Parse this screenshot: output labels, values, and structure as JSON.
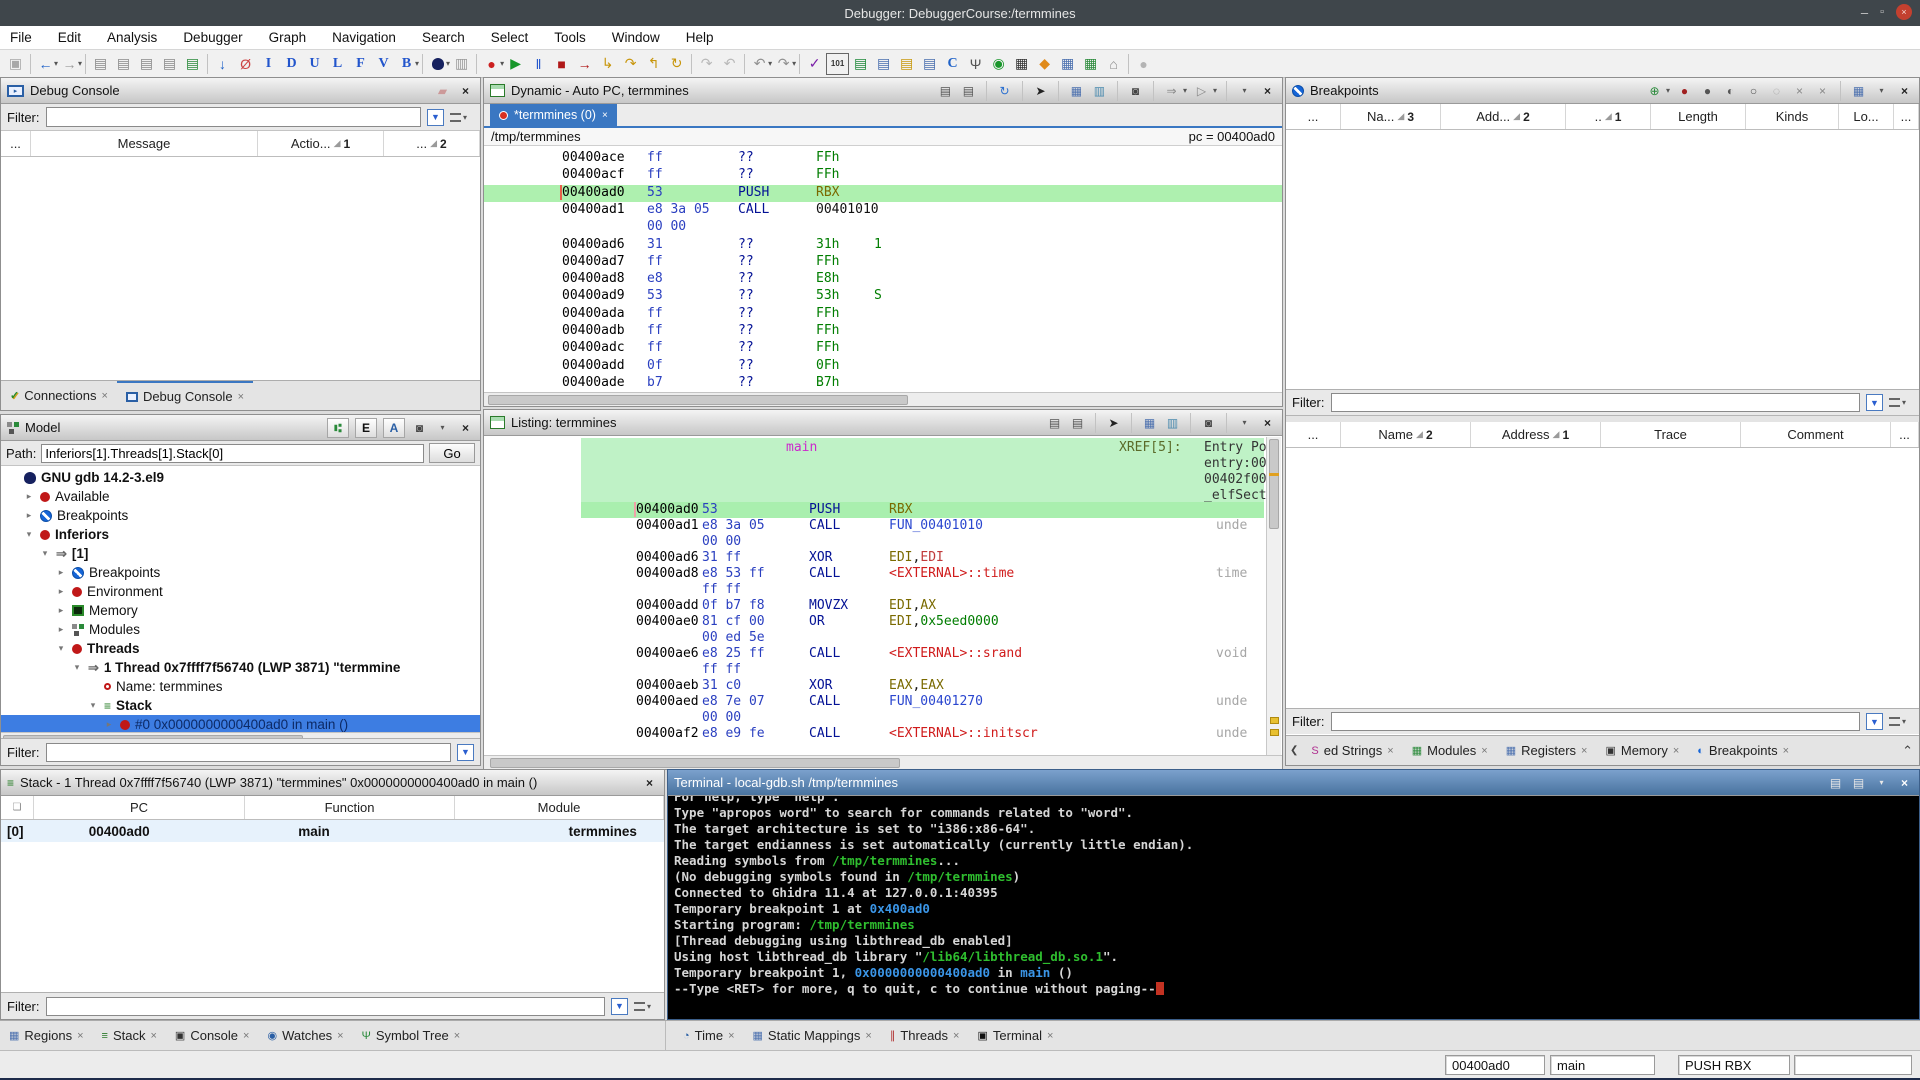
{
  "window": {
    "title": "Debugger: DebuggerCourse:/termmines"
  },
  "menu": {
    "items": [
      "File",
      "Edit",
      "Analysis",
      "Debugger",
      "Graph",
      "Navigation",
      "Search",
      "Select",
      "Tools",
      "Window",
      "Help"
    ]
  },
  "toolbar": {
    "items": [
      {
        "name": "save-button",
        "glyph": "▣",
        "color": "#a8a8a8"
      },
      {
        "name": "sep"
      },
      {
        "name": "navigate-back-button",
        "glyph": "←",
        "color": "#1f62c8",
        "caret": true
      },
      {
        "name": "navigate-forward-button",
        "glyph": "→",
        "color": "#9a9a9a",
        "caret": true
      },
      {
        "name": "sep"
      },
      {
        "name": "paste-1-button",
        "glyph": "▤",
        "color": "#8a8a8a"
      },
      {
        "name": "paste-2-button",
        "glyph": "▤",
        "color": "#8a8a8a"
      },
      {
        "name": "paste-3-button",
        "glyph": "▤",
        "color": "#8a8a8a"
      },
      {
        "name": "paste-4-button",
        "glyph": "▤",
        "color": "#8a8a8a"
      },
      {
        "name": "paste-green-button",
        "glyph": "▤",
        "color": "#2a8a3a"
      },
      {
        "name": "sep"
      },
      {
        "name": "cursor-location-button",
        "glyph": "↓",
        "color": "#1f62c8"
      },
      {
        "name": "clear-code-button",
        "glyph": "Ø",
        "color": "#cc4444"
      },
      {
        "name": "data-i-button",
        "glyph": "I",
        "color": "#2255cc"
      },
      {
        "name": "data-d-button",
        "glyph": "D",
        "color": "#2255cc"
      },
      {
        "name": "data-u-button",
        "glyph": "U",
        "color": "#2255cc"
      },
      {
        "name": "data-l-button",
        "glyph": "L",
        "color": "#2255cc"
      },
      {
        "name": "data-f-button",
        "glyph": "F",
        "color": "#2255cc"
      },
      {
        "name": "data-v-button",
        "glyph": "V",
        "color": "#2255cc"
      },
      {
        "name": "data-b-button",
        "glyph": "B",
        "color": "#2255cc",
        "caret": true
      },
      {
        "name": "sep"
      },
      {
        "name": "debug-program-button",
        "glyph": "",
        "color": "#16215f",
        "bug": true,
        "caret": true
      },
      {
        "name": "attach-button",
        "glyph": "▥",
        "color": "#9a9a9a"
      },
      {
        "name": "sep"
      },
      {
        "name": "record-button",
        "glyph": "●",
        "color": "#cc2020",
        "caret": true
      },
      {
        "name": "resume-button",
        "glyph": "▶",
        "color": "#18962a"
      },
      {
        "name": "interrupt-button",
        "glyph": "‖",
        "color": "#2255cc"
      },
      {
        "name": "kill-button",
        "glyph": "■",
        "color": "#b01818"
      },
      {
        "name": "advance-button",
        "glyph": "→",
        "color": "#b01818"
      },
      {
        "name": "step-into-button",
        "glyph": "↳",
        "color": "#c8960c"
      },
      {
        "name": "step-over-button",
        "glyph": "↷",
        "color": "#c8960c"
      },
      {
        "name": "step-out-button",
        "glyph": "↰",
        "color": "#c8960c"
      },
      {
        "name": "step-last-button",
        "glyph": "↻",
        "color": "#c8960c"
      },
      {
        "name": "sep"
      },
      {
        "name": "skip-over-button",
        "glyph": "↷",
        "color": "#b8b8b8"
      },
      {
        "name": "skip-into-button",
        "glyph": "↶",
        "color": "#b8b8b8"
      },
      {
        "name": "sep"
      },
      {
        "name": "undo-button",
        "glyph": "↶",
        "color": "#909090",
        "caret": true
      },
      {
        "name": "redo-button",
        "glyph": "↷",
        "color": "#909090",
        "caret": true
      },
      {
        "name": "sep"
      },
      {
        "name": "apply-button",
        "glyph": "✓",
        "color": "#7a1fa8"
      },
      {
        "name": "binary-button",
        "glyph": "⑁",
        "color": "#333",
        "text": "101"
      },
      {
        "name": "allocate-button",
        "glyph": "▤",
        "color": "#1f8a3a"
      },
      {
        "name": "list-1-button",
        "glyph": "▤",
        "color": "#4a6fae"
      },
      {
        "name": "dyn-folder-button",
        "glyph": "▤",
        "color": "#c89a10"
      },
      {
        "name": "list-2-button",
        "glyph": "▤",
        "color": "#4a6fae"
      },
      {
        "name": "c-type-button",
        "glyph": "C",
        "color": "#1f62c8"
      },
      {
        "name": "symbol-tree-button",
        "glyph": "Ψ",
        "color": "#555"
      },
      {
        "name": "run-script-button",
        "glyph": "◉",
        "color": "#18962a"
      },
      {
        "name": "film-button",
        "glyph": "▦",
        "color": "#333"
      },
      {
        "name": "diamond-button",
        "glyph": "◆",
        "color": "#e08a1a"
      },
      {
        "name": "table-1-button",
        "glyph": "▦",
        "color": "#4a6fae"
      },
      {
        "name": "table-2-button",
        "glyph": "▦",
        "color": "#2a8a3a"
      },
      {
        "name": "stamp-button",
        "glyph": "⌂",
        "color": "#8a8a8a"
      },
      {
        "name": "sep"
      },
      {
        "name": "snapshot-button",
        "glyph": "●",
        "color": "#b4b4b4"
      }
    ]
  },
  "debug_console": {
    "title": "Debug Console",
    "filter_label": "Filter:",
    "filter_value": "",
    "columns": [
      {
        "label": "..."
      },
      {
        "label": "Message"
      },
      {
        "label": "Actio...",
        "sort": 1
      },
      {
        "label": "...",
        "sort": 2
      }
    ],
    "tabs": [
      {
        "label": "Connections"
      },
      {
        "label": "Debug Console"
      }
    ]
  },
  "model": {
    "title": "Model",
    "path_label": "Path:",
    "path_value": "Inferiors[1].Threads[1].Stack[0]",
    "go_label": "Go",
    "filter_label": "Filter:",
    "filter_value": "",
    "tree": [
      {
        "label": "GNU gdb 14.2-3.el9",
        "icon": "bug-icon",
        "bold": true,
        "level": 0,
        "exp": ""
      },
      {
        "label": "Available",
        "icon": "red-dot-icon",
        "level": 1,
        "exp": "▸"
      },
      {
        "label": "Breakpoints",
        "icon": "breakpoint-icon",
        "level": 1,
        "exp": "▸"
      },
      {
        "label": "Inferiors",
        "icon": "red-dot-icon",
        "bold": true,
        "level": 1,
        "exp": "▾"
      },
      {
        "label": "[1]",
        "icon": "arrow-icon",
        "bold": true,
        "level": 2,
        "exp": "▾"
      },
      {
        "label": "Breakpoints",
        "icon": "breakpoint-icon",
        "level": 3,
        "exp": "▸"
      },
      {
        "label": "Environment",
        "icon": "red-dot-icon",
        "level": 3,
        "exp": "▸"
      },
      {
        "label": "Memory",
        "icon": "memory-icon",
        "level": 3,
        "exp": "▸"
      },
      {
        "label": "Modules",
        "icon": "modules-icon",
        "level": 3,
        "exp": "▸"
      },
      {
        "label": "Threads",
        "icon": "red-dot-icon",
        "bold": true,
        "level": 3,
        "exp": "▾"
      },
      {
        "label": "1    Thread 0x7ffff7f56740 (LWP 3871) \"termmine",
        "icon": "arrow-icon",
        "bold": true,
        "level": 4,
        "exp": "▾"
      },
      {
        "label": "Name: termmines",
        "icon": "ring-icon",
        "level": 5,
        "exp": ""
      },
      {
        "label": "Stack",
        "icon": "stack-icon",
        "bold": true,
        "level": 5,
        "exp": "▾"
      },
      {
        "label": "#0  0x0000000000400ad0 in main ()",
        "icon": "red-dot-icon",
        "level": 6,
        "exp": "▸",
        "selected": true
      }
    ]
  },
  "stack": {
    "title": "Stack - 1   Thread 0x7ffff7f56740 (LWP 3871) \"termmines\" 0x0000000000400ad0 in main ()",
    "columns": [
      "",
      "PC",
      "Function",
      "Module"
    ],
    "rows": [
      {
        "index": "[0]",
        "pc": "00400ad0",
        "function": "main",
        "module": "termmines"
      }
    ],
    "filter_label": "Filter:",
    "filter_value": ""
  },
  "dynamic": {
    "title": "Dynamic - Auto PC, termmines",
    "tab_label": "*termmines (0)",
    "path": "/tmp/termmines",
    "pc_label": "pc = 00400ad0",
    "rows": [
      {
        "a": "00400ace",
        "b": "ff",
        "m": "??",
        "o": [
          [
            "FFh",
            "c-const"
          ]
        ]
      },
      {
        "a": "00400acf",
        "b": "ff",
        "m": "??",
        "o": [
          [
            "FFh",
            "c-const"
          ]
        ]
      },
      {
        "a": "00400ad0",
        "b": "53",
        "m": "PUSH",
        "o": [
          [
            "RBX",
            "c-reg"
          ]
        ],
        "hl": true,
        "cursor": true
      },
      {
        "a": "00400ad1",
        "b": "e8 3a 05",
        "m": "CALL",
        "o": [
          [
            "00401010",
            "c-plain"
          ]
        ]
      },
      {
        "cont": "00 00"
      },
      {
        "a": "00400ad6",
        "b": "31",
        "m": "??",
        "o": [
          [
            "31h",
            "c-const"
          ]
        ],
        "x": "1"
      },
      {
        "a": "00400ad7",
        "b": "ff",
        "m": "??",
        "o": [
          [
            "FFh",
            "c-const"
          ]
        ]
      },
      {
        "a": "00400ad8",
        "b": "e8",
        "m": "??",
        "o": [
          [
            "E8h",
            "c-const"
          ]
        ]
      },
      {
        "a": "00400ad9",
        "b": "53",
        "m": "??",
        "o": [
          [
            "53h",
            "c-const"
          ]
        ],
        "x": "S"
      },
      {
        "a": "00400ada",
        "b": "ff",
        "m": "??",
        "o": [
          [
            "FFh",
            "c-const"
          ]
        ]
      },
      {
        "a": "00400adb",
        "b": "ff",
        "m": "??",
        "o": [
          [
            "FFh",
            "c-const"
          ]
        ]
      },
      {
        "a": "00400adc",
        "b": "ff",
        "m": "??",
        "o": [
          [
            "FFh",
            "c-const"
          ]
        ]
      },
      {
        "a": "00400add",
        "b": "0f",
        "m": "??",
        "o": [
          [
            "0Fh",
            "c-const"
          ]
        ]
      },
      {
        "a": "00400ade",
        "b": "b7",
        "m": "??",
        "o": [
          [
            "B7h",
            "c-const"
          ]
        ]
      }
    ]
  },
  "listing": {
    "title": "Listing: termmines",
    "function_label": "main",
    "xref_label": "XREF[5]:",
    "xrefs": [
      "Entry Po",
      "entry:00",
      "00402f00",
      "_elfSect"
    ],
    "rows": [
      {
        "a": "00400ad0",
        "b": "53",
        "m": "PUSH",
        "o": [
          [
            "RBX",
            "c-reg"
          ]
        ],
        "hl": true,
        "cursor": true
      },
      {
        "a": "00400ad1",
        "b": "e8 3a 05",
        "m": "CALL",
        "o": [
          [
            "FUN_00401010",
            "c-fun"
          ]
        ],
        "cm": "unde"
      },
      {
        "cont": "00 00"
      },
      {
        "a": "00400ad6",
        "b": "31 ff",
        "m": "XOR",
        "o": [
          [
            "EDI",
            "c-reg"
          ],
          [
            ",",
            "c-plain"
          ],
          [
            "EDI",
            "c-reg2"
          ]
        ]
      },
      {
        "a": "00400ad8",
        "b": "e8 53 ff",
        "m": "CALL",
        "o": [
          [
            "<EXTERNAL>::time",
            "c-ext"
          ]
        ],
        "cm": "time"
      },
      {
        "cont": "ff ff"
      },
      {
        "a": "00400add",
        "b": "0f b7 f8",
        "m": "MOVZX",
        "o": [
          [
            "EDI",
            "c-reg"
          ],
          [
            ",",
            "c-plain"
          ],
          [
            "AX",
            "c-reg"
          ]
        ]
      },
      {
        "a": "00400ae0",
        "b": "81 cf 00",
        "m": "OR",
        "o": [
          [
            "EDI",
            "c-reg"
          ],
          [
            ",",
            "c-plain"
          ],
          [
            "0x5eed0000",
            "c-const"
          ]
        ]
      },
      {
        "cont": "00 ed 5e"
      },
      {
        "a": "00400ae6",
        "b": "e8 25 ff",
        "m": "CALL",
        "o": [
          [
            "<EXTERNAL>::srand",
            "c-ext"
          ]
        ],
        "cm": "void"
      },
      {
        "cont": "ff ff"
      },
      {
        "a": "00400aeb",
        "b": "31 c0",
        "m": "XOR",
        "o": [
          [
            "EAX",
            "c-reg"
          ],
          [
            ",",
            "c-plain"
          ],
          [
            "EAX",
            "c-reg"
          ]
        ]
      },
      {
        "a": "00400aed",
        "b": "e8 7e 07",
        "m": "CALL",
        "o": [
          [
            "FUN_00401270",
            "c-fun"
          ]
        ],
        "cm": "unde"
      },
      {
        "cont": "00 00"
      },
      {
        "a": "00400af2",
        "b": "e8 e9 fe",
        "m": "CALL",
        "o": [
          [
            "<EXTERNAL>::initscr",
            "c-ext"
          ]
        ],
        "cm": "unde"
      }
    ]
  },
  "breakpoints": {
    "title": "Breakpoints",
    "filter_label": "Filter:",
    "filter_value": "",
    "columns1": [
      {
        "label": "..."
      },
      {
        "label": "Na...",
        "sort": 3
      },
      {
        "label": "Add...",
        "sort": 2
      },
      {
        "label": "..",
        "sort": 1
      },
      {
        "label": "Length"
      },
      {
        "label": "Kinds"
      },
      {
        "label": "Lo..."
      },
      {
        "label": "..."
      }
    ],
    "columns2": [
      {
        "label": "..."
      },
      {
        "label": "Name",
        "sort": 2
      },
      {
        "label": "Address",
        "sort": 1
      },
      {
        "label": "Trace"
      },
      {
        "label": "Comment"
      },
      {
        "label": "..."
      }
    ],
    "header_icons": [
      "set-breakpoint-icon",
      "enable-breakpoint-icon",
      "enable-all-icon",
      "toggle-breakpoint-icon",
      "disable-breakpoint-icon",
      "clear-breakpoint-icon",
      "clear-all-icon",
      "clear-all-2-icon",
      "make-effective-icon",
      "table-settings-icon",
      "close-icon"
    ],
    "tabs": [
      {
        "label": "ed Strings"
      },
      {
        "label": "Modules"
      },
      {
        "label": "Registers"
      },
      {
        "label": "Memory"
      },
      {
        "label": "Breakpoints"
      }
    ]
  },
  "terminal": {
    "title": "Terminal - local-gdb.sh /tmp/termmines",
    "lines": [
      [
        {
          "t": "For help, type \"help\".",
          "c": "p"
        }
      ],
      [
        {
          "t": "Type \"apropos word\" to search for commands related to \"word\".",
          "c": "p"
        }
      ],
      [
        {
          "t": "The target architecture is set to \"i386:x86-64\".",
          "c": "p"
        }
      ],
      [
        {
          "t": "The target endianness is set automatically (currently little endian).",
          "c": "p"
        }
      ],
      [
        {
          "t": "Reading symbols from ",
          "c": "p"
        },
        {
          "t": "/tmp/termmines",
          "c": "g"
        },
        {
          "t": "...",
          "c": "p"
        }
      ],
      [
        {
          "t": "(No debugging symbols found in ",
          "c": "p"
        },
        {
          "t": "/tmp/termmines",
          "c": "g"
        },
        {
          "t": ")",
          "c": "p"
        }
      ],
      [
        {
          "t": "Connected to Ghidra 11.4 at 127.0.0.1:40395",
          "c": "p"
        }
      ],
      [
        {
          "t": "Temporary breakpoint 1 at ",
          "c": "p"
        },
        {
          "t": "0x400ad0",
          "c": "b"
        }
      ],
      [
        {
          "t": "Starting program: ",
          "c": "p"
        },
        {
          "t": "/tmp/termmines",
          "c": "g"
        }
      ],
      [
        {
          "t": "[Thread debugging using libthread_db enabled]",
          "c": "p"
        }
      ],
      [
        {
          "t": "Using host libthread_db library \"",
          "c": "p"
        },
        {
          "t": "/lib64/libthread_db.so.1",
          "c": "g"
        },
        {
          "t": "\".",
          "c": "p"
        }
      ],
      [
        {
          "t": "",
          "c": "p"
        }
      ],
      [
        {
          "t": "Temporary breakpoint 1, ",
          "c": "p"
        },
        {
          "t": "0x0000000000400ad0",
          "c": "b"
        },
        {
          "t": " in ",
          "c": "p"
        },
        {
          "t": "main",
          "c": "b"
        },
        {
          "t": " ()",
          "c": "p"
        }
      ],
      [
        {
          "t": "--Type <RET> for more, q to quit, c to continue without paging--",
          "c": "p"
        },
        {
          "t": "CURSOR",
          "c": "cur"
        }
      ]
    ]
  },
  "bottom_tabs": {
    "left": [
      {
        "label": "Regions",
        "icon": "regions-icon"
      },
      {
        "label": "Stack",
        "icon": "stack-icon"
      },
      {
        "label": "Console",
        "icon": "console-icon"
      },
      {
        "label": "Watches",
        "icon": "watches-icon"
      },
      {
        "label": "Symbol Tree",
        "icon": "symbol-tree-icon"
      }
    ],
    "right": [
      {
        "label": "Time",
        "icon": "time-icon"
      },
      {
        "label": "Static Mappings",
        "icon": "static-mappings-icon"
      },
      {
        "label": "Threads",
        "icon": "threads-icon"
      },
      {
        "label": "Terminal",
        "icon": "terminal-icon"
      }
    ]
  },
  "status": {
    "address": "00400ad0",
    "function": "main",
    "instruction": "PUSH RBX"
  }
}
